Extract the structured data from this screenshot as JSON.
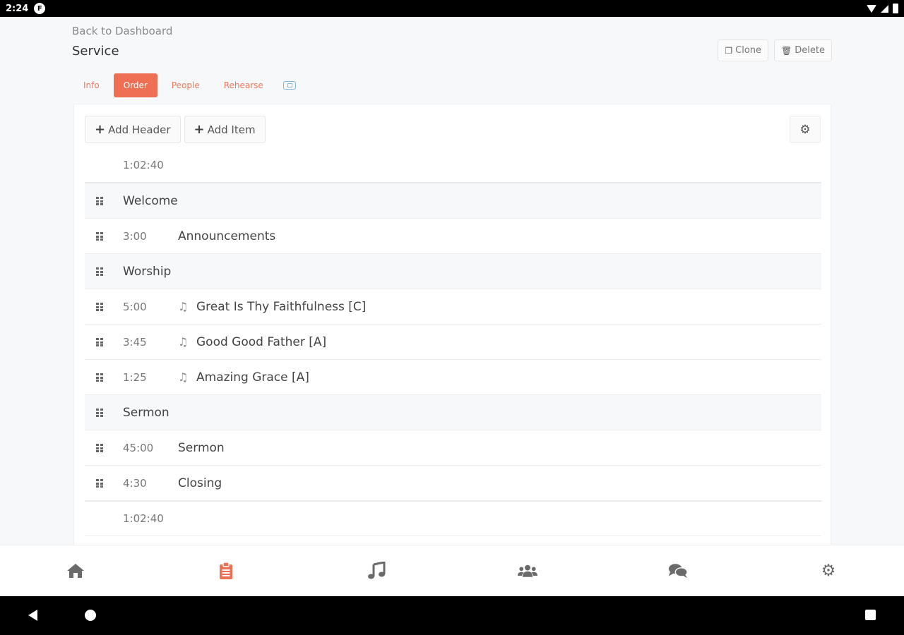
{
  "status_bar": {
    "time": "2:24",
    "app_badge": "F"
  },
  "page": {
    "back_link": "Back to Dashboard",
    "title": "Service",
    "clone_label": "Clone",
    "delete_label": "Delete"
  },
  "tabs": [
    {
      "label": "Info",
      "active": false
    },
    {
      "label": "Order",
      "active": true
    },
    {
      "label": "People",
      "active": false
    },
    {
      "label": "Rehearse",
      "active": false
    }
  ],
  "toolbar": {
    "add_header": "Add Header",
    "add_item": "Add Item"
  },
  "order": {
    "total_top": "1:02:40",
    "rows": [
      {
        "type": "header",
        "label": "Welcome"
      },
      {
        "type": "item",
        "duration": "3:00",
        "label": "Announcements",
        "song": false
      },
      {
        "type": "header",
        "label": "Worship"
      },
      {
        "type": "item",
        "duration": "5:00",
        "label": "Great Is Thy Faithfulness [C]",
        "song": true
      },
      {
        "type": "item",
        "duration": "3:45",
        "label": "Good Good Father [A]",
        "song": true
      },
      {
        "type": "item",
        "duration": "1:25",
        "label": "Amazing Grace [A]",
        "song": true
      },
      {
        "type": "header",
        "label": "Sermon"
      },
      {
        "type": "item",
        "duration": "45:00",
        "label": "Sermon",
        "song": false
      },
      {
        "type": "item",
        "duration": "4:30",
        "label": "Closing",
        "song": false
      }
    ],
    "total_bottom": "1:02:40"
  },
  "bottom_nav": [
    {
      "icon": "home-icon",
      "active": false
    },
    {
      "icon": "clipboard-icon",
      "active": true
    },
    {
      "icon": "music-icon",
      "active": false
    },
    {
      "icon": "people-icon",
      "active": false
    },
    {
      "icon": "chat-icon",
      "active": false
    },
    {
      "icon": "gear-icon",
      "active": false
    }
  ],
  "colors": {
    "accent": "#ee6f53",
    "header_row_bg": "#f6f8fa"
  }
}
